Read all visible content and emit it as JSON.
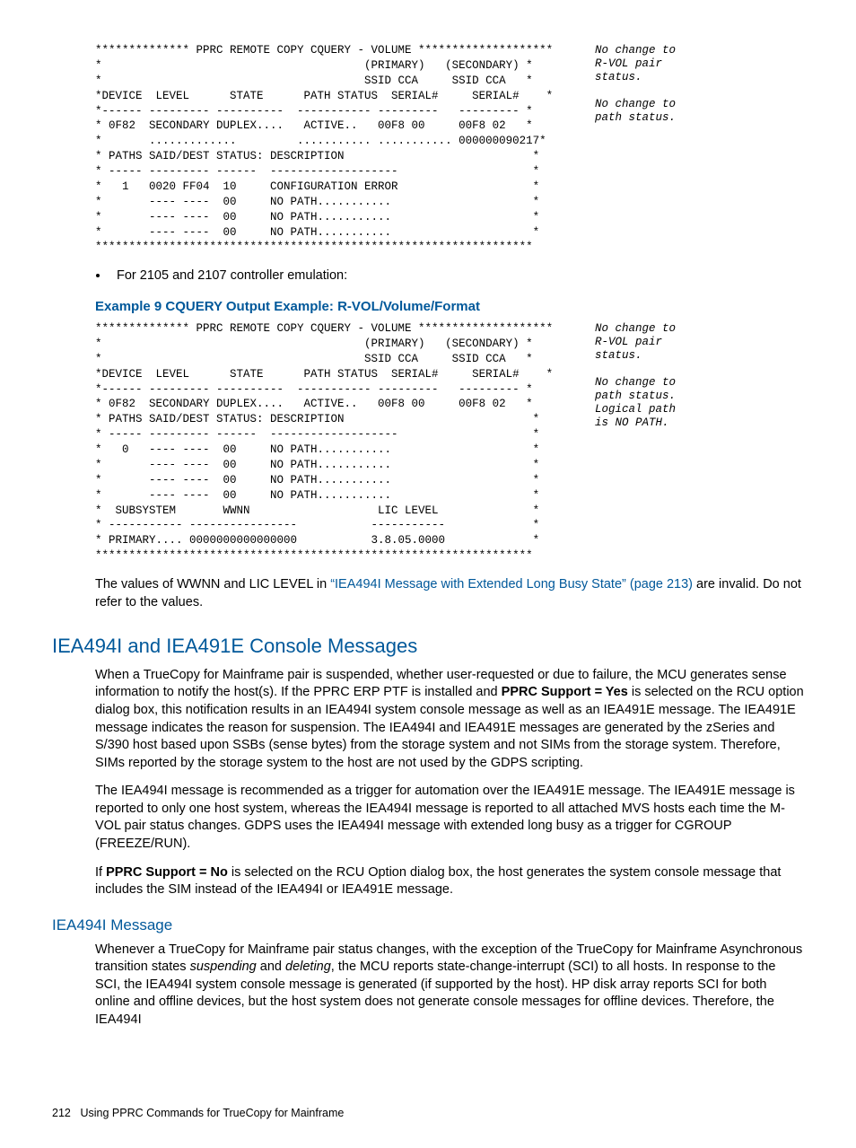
{
  "code1": "************** PPRC REMOTE COPY CQUERY - VOLUME ********************\n*                                       (PRIMARY)   (SECONDARY) *\n*                                       SSID CCA     SSID CCA   *\n*DEVICE  LEVEL      STATE      PATH STATUS  SERIAL#     SERIAL#    *\n*------ --------- ----------  ----------- ---------   --------- *\n* 0F82  SECONDARY DUPLEX....   ACTIVE..   00F8 00     00F8 02   *\n*       .............         ........... ........... 000000090217*\n* PATHS SAID/DEST STATUS: DESCRIPTION                            *\n* ----- --------- ------  -------------------                    *\n*   1   0020 FF04  10     CONFIGURATION ERROR                    *\n*       ---- ----  00     NO PATH...........                     *\n*       ---- ----  00     NO PATH...........                     *\n*       ---- ----  00     NO PATH...........                     *\n*****************************************************************",
  "annot1": [
    "No change to",
    "R-VOL pair",
    "status.",
    "",
    "No change to",
    "path status."
  ],
  "bullet1": "For 2105 and 2107 controller emulation:",
  "example_caption": "Example 9 CQUERY Output Example: R-VOL/Volume/Format",
  "code2": "************** PPRC REMOTE COPY CQUERY - VOLUME ********************\n*                                       (PRIMARY)   (SECONDARY) *\n*                                       SSID CCA     SSID CCA   *\n*DEVICE  LEVEL      STATE      PATH STATUS  SERIAL#     SERIAL#    *\n*------ --------- ----------  ----------- ---------   --------- *\n* 0F82  SECONDARY DUPLEX....   ACTIVE..   00F8 00     00F8 02   *\n* PATHS SAID/DEST STATUS: DESCRIPTION                            *\n* ----- --------- ------  -------------------                    *\n*   0   ---- ----  00     NO PATH...........                     *\n*       ---- ----  00     NO PATH...........                     *\n*       ---- ----  00     NO PATH...........                     *\n*       ---- ----  00     NO PATH...........                     *\n*  SUBSYSTEM       WWNN                   LIC LEVEL              *\n* ----------- ----------------           -----------             *\n* PRIMARY.... 0000000000000000           3.8.05.0000             *\n*****************************************************************",
  "annot2": [
    "No change to",
    "R-VOL pair",
    "status.",
    "",
    "No change to",
    "path status.",
    "Logical path",
    "is NO PATH."
  ],
  "para_after_code": {
    "pre": "The values of WWNN and LIC LEVEL in ",
    "link": "“IEA494I Message with Extended Long Busy State” (page 213)",
    "post": " are invalid. Do not refer to the values."
  },
  "h2": "IEA494I and IEA491E Console Messages",
  "p1a": "When a TrueCopy for Mainframe pair is suspended, whether user-requested or due to failure, the MCU generates sense information to notify the host(s). If the PPRC ERP PTF is installed and ",
  "p1b": "PPRC Support = Yes",
  "p1c": " is selected on the RCU option dialog box, this notification results in an IEA494I system console message as well as an IEA491E message. The IEA491E message indicates the reason for suspension. The IEA494I and IEA491E messages are generated by the zSeries and S/390 host based upon SSBs (sense bytes) from the storage system and not SIMs from the storage system. Therefore, SIMs reported by the storage system to the host are not used by the GDPS scripting.",
  "p2": "The IEA494I message is recommended as a trigger for automation over the IEA491E message. The IEA491E message is reported to only one host system, whereas the IEA494I message is reported to all attached MVS hosts each time the M-VOL pair status changes. GDPS uses the IEA494I message with extended long busy as a trigger for CGROUP (FREEZE/RUN).",
  "p3a": "If ",
  "p3b": "PPRC Support = No",
  "p3c": " is selected on the RCU Option dialog box, the host generates the system console message that includes the SIM instead of the IEA494I or IEA491E message.",
  "h3": "IEA494I Message",
  "p4a": "Whenever a TrueCopy for Mainframe pair status changes, with the exception of the TrueCopy for Mainframe Asynchronous transition states ",
  "p4b": "suspending",
  "p4c": " and ",
  "p4d": "deleting",
  "p4e": ", the MCU reports state-change-interrupt (SCI) to all hosts. In response to the SCI, the IEA494I system console message is generated (if supported by the host). HP disk array reports SCI for both online and offline devices, but the host system does not generate console messages for offline devices. Therefore, the IEA494I",
  "footer_page": "212",
  "footer_text": "Using PPRC Commands for TrueCopy for Mainframe"
}
